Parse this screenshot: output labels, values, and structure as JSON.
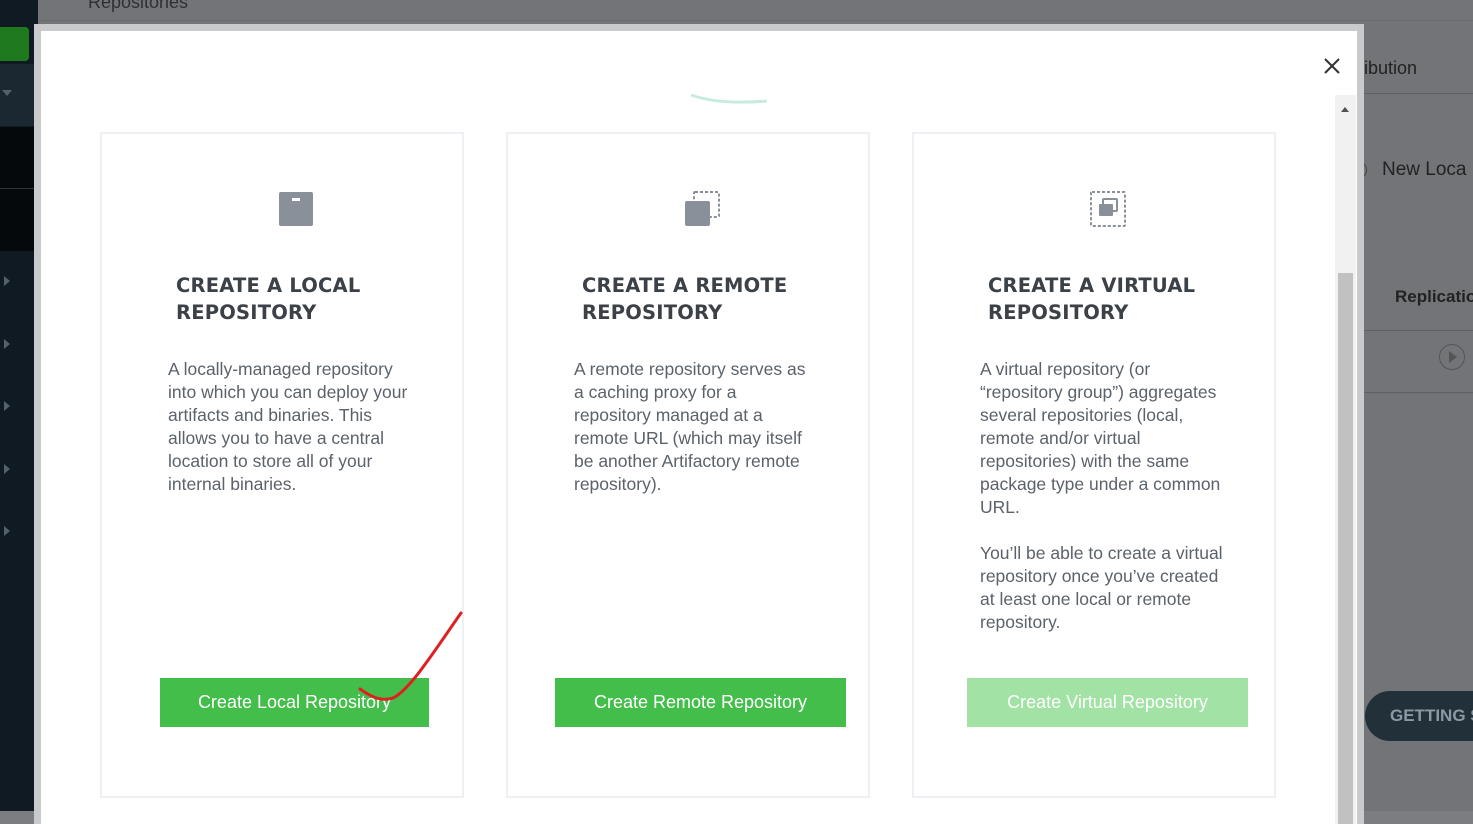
{
  "background": {
    "header_title": "Repositories",
    "tab_label": "tribution",
    "new_local_label": "New Loca",
    "column_x": "x",
    "column_replication": "Replicatio",
    "getting_started_label": "GETTING S"
  },
  "modal": {
    "close_icon": "close-icon",
    "cards": [
      {
        "icon": "local-repo-icon",
        "title": "CREATE A LOCAL\nREPOSITORY",
        "description": "A locally-managed repository\ninto which you can deploy your\nartifacts and binaries. This\nallows you to have a central\nlocation to store all of your\ninternal binaries.",
        "button_label": "Create Local Repository",
        "button_enabled": true
      },
      {
        "icon": "remote-repo-icon",
        "title": "CREATE A REMOTE\nREPOSITORY",
        "description": "A remote repository serves as\na caching proxy for a\nrepository managed at a\nremote URL (which may itself\nbe another Artifactory remote\nrepository).",
        "button_label": "Create Remote Repository",
        "button_enabled": true
      },
      {
        "icon": "virtual-repo-icon",
        "title": "CREATE A VIRTUAL\nREPOSITORY",
        "description": "A virtual repository (or\n“repository group”) aggregates\nseveral repositories (local,\nremote and/or virtual\nrepositories) with the same\npackage type under a common\nURL.\n\nYou’ll be able to create a virtual\nrepository once you’ve created\nat least one local or remote\nrepository.",
        "button_label": "Create Virtual Repository",
        "button_enabled": false
      }
    ]
  },
  "colors": {
    "button_green": "#43be4a",
    "button_disabled": "#a3e2a5",
    "annotation_red": "#e02020"
  }
}
